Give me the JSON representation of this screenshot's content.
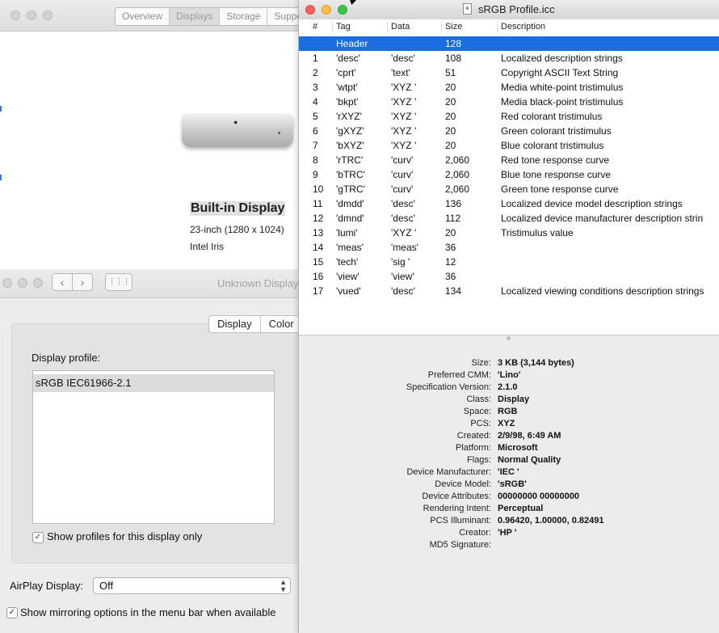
{
  "about_window": {
    "tabs": [
      "Overview",
      "Displays",
      "Storage",
      "Suppo"
    ],
    "selected_tab": "Displays",
    "display_name": "Built-in Display",
    "display_resolution": "23-inch (1280 x 1024)",
    "graphics": "Intel Iris"
  },
  "prefs_window": {
    "title": "Unknown Display",
    "nav": {
      "back": "‹",
      "forward": "›"
    },
    "pane_tabs": [
      "Display",
      "Color"
    ],
    "profile_label": "Display profile:",
    "profiles": [
      "sRGB IEC61966-2.1"
    ],
    "show_only_label": "Show profiles for this display only",
    "show_only_checked": true,
    "airplay_label": "AirPlay Display:",
    "airplay_value": "Off",
    "mirror_label": "Show mirroring options in the menu bar when available",
    "mirror_checked": true
  },
  "icc_window": {
    "title": "sRGB Profile.icc",
    "columns": [
      "#",
      "Tag",
      "Data",
      "Size",
      "Description"
    ],
    "rows": [
      {
        "num": "",
        "tag": "Header",
        "data": "",
        "size": "128",
        "desc": "",
        "selected": true
      },
      {
        "num": "1",
        "tag": "'desc'",
        "data": "'desc'",
        "size": "108",
        "desc": "Localized description strings"
      },
      {
        "num": "2",
        "tag": "'cprt'",
        "data": "'text'",
        "size": "51",
        "desc": "Copyright ASCII Text String"
      },
      {
        "num": "3",
        "tag": "'wtpt'",
        "data": "'XYZ '",
        "size": "20",
        "desc": "Media white-point tristimulus"
      },
      {
        "num": "4",
        "tag": "'bkpt'",
        "data": "'XYZ '",
        "size": "20",
        "desc": "Media black-point tristimulus"
      },
      {
        "num": "5",
        "tag": "'rXYZ'",
        "data": "'XYZ '",
        "size": "20",
        "desc": "Red colorant tristimulus"
      },
      {
        "num": "6",
        "tag": "'gXYZ'",
        "data": "'XYZ '",
        "size": "20",
        "desc": "Green colorant tristimulus"
      },
      {
        "num": "7",
        "tag": "'bXYZ'",
        "data": "'XYZ '",
        "size": "20",
        "desc": "Blue colorant tristimulus"
      },
      {
        "num": "8",
        "tag": "'rTRC'",
        "data": "'curv'",
        "size": "2,060",
        "desc": "Red tone response curve"
      },
      {
        "num": "9",
        "tag": "'bTRC'",
        "data": "'curv'",
        "size": "2,060",
        "desc": "Blue tone response curve"
      },
      {
        "num": "10",
        "tag": "'gTRC'",
        "data": "'curv'",
        "size": "2,060",
        "desc": "Green tone response curve"
      },
      {
        "num": "11",
        "tag": "'dmdd'",
        "data": "'desc'",
        "size": "136",
        "desc": "Localized device model description strings"
      },
      {
        "num": "12",
        "tag": "'dmnd'",
        "data": "'desc'",
        "size": "112",
        "desc": "Localized device manufacturer description strin"
      },
      {
        "num": "13",
        "tag": "'lumi'",
        "data": "'XYZ '",
        "size": "20",
        "desc": "Tristimulus value"
      },
      {
        "num": "14",
        "tag": "'meas'",
        "data": "'meas'",
        "size": "36",
        "desc": ""
      },
      {
        "num": "15",
        "tag": "'tech'",
        "data": "'sig '",
        "size": "12",
        "desc": ""
      },
      {
        "num": "16",
        "tag": "'view'",
        "data": "'view'",
        "size": "36",
        "desc": ""
      },
      {
        "num": "17",
        "tag": "'vued'",
        "data": "'desc'",
        "size": "134",
        "desc": "Localized viewing conditions description strings"
      }
    ],
    "info": [
      {
        "k": "Size:",
        "v": "3 KB (3,144 bytes)"
      },
      {
        "k": "Preferred CMM:",
        "v": "'Lino'"
      },
      {
        "k": "Specification Version:",
        "v": "2.1.0"
      },
      {
        "k": "Class:",
        "v": "Display"
      },
      {
        "k": "Space:",
        "v": "RGB"
      },
      {
        "k": "PCS:",
        "v": "XYZ"
      },
      {
        "k": "Created:",
        "v": "2/9/98, 6:49 AM"
      },
      {
        "k": "Platform:",
        "v": "Microsoft"
      },
      {
        "k": "Flags:",
        "v": "Normal Quality"
      },
      {
        "k": "Device Manufacturer:",
        "v": "'IEC '"
      },
      {
        "k": "Device Model:",
        "v": "'sRGB'"
      },
      {
        "k": "Device Attributes:",
        "v": "00000000 00000000"
      },
      {
        "k": "Rendering Intent:",
        "v": "Perceptual"
      },
      {
        "k": "PCS Illuminant:",
        "v": "0.96420, 1.00000, 0.82491"
      },
      {
        "k": "Creator:",
        "v": "'HP  '"
      },
      {
        "k": "MD5 Signature:",
        "v": ""
      }
    ]
  },
  "colors": {
    "selection_blue": "#1c6de0",
    "close_red": "#fc605c",
    "minimize_yellow": "#fdbc40",
    "zoom_green": "#34c84a"
  }
}
